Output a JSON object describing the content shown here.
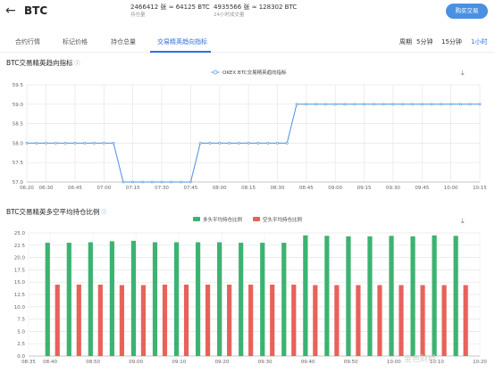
{
  "header": {
    "back_icon": "back-arrow-icon",
    "coin": "BTC",
    "stat1": {
      "value": "2466412 张 ≈ 64125 BTC",
      "label": "持仓量"
    },
    "stat2": {
      "value": "4935566 张 ≈ 128302 BTC",
      "label": "24小时成交量"
    },
    "buy_button": "购买交易"
  },
  "tabs": [
    {
      "label": "合约行情"
    },
    {
      "label": "标记价格"
    },
    {
      "label": "持仓总量"
    },
    {
      "label": "交易精英趋向指标",
      "active": true
    }
  ],
  "periods": {
    "label": "周期",
    "options": [
      {
        "label": "5分钟"
      },
      {
        "label": "15分钟"
      },
      {
        "label": "1小时",
        "active": true
      }
    ]
  },
  "watermark": "金色财经",
  "chart_data": [
    {
      "type": "line",
      "title": "BTC交易精英趋向指标",
      "legend": [
        "OKEX BTC交易精英趋向指标"
      ],
      "legend_position": "top-center",
      "grid": true,
      "ylim": [
        57.0,
        59.5
      ],
      "yticks": [
        "57.0",
        "57.5",
        "58.0",
        "58.5",
        "59.0",
        "59.5"
      ],
      "xticks": [
        "06:20",
        "06:30",
        "06:45",
        "07:00",
        "07:15",
        "07:30",
        "07:45",
        "08:00",
        "08:15",
        "08:30",
        "08:45",
        "09:00",
        "09:15",
        "09:30",
        "09:45",
        "10:00",
        "10:15"
      ],
      "series": [
        {
          "name": "OKEX BTC交易精英趋向指标",
          "color": "#4a90e2",
          "x": [
            "06:20",
            "06:25",
            "06:30",
            "06:35",
            "06:40",
            "06:45",
            "06:50",
            "06:55",
            "07:00",
            "07:05",
            "07:10",
            "07:15",
            "07:20",
            "07:25",
            "07:30",
            "07:35",
            "07:40",
            "07:45",
            "07:50",
            "07:55",
            "08:00",
            "08:05",
            "08:10",
            "08:15",
            "08:20",
            "08:25",
            "08:30",
            "08:35",
            "08:40",
            "08:45",
            "08:50",
            "08:55",
            "09:00",
            "09:05",
            "09:10",
            "09:15",
            "09:20",
            "09:25",
            "09:30",
            "09:35",
            "09:40",
            "09:45",
            "09:50",
            "09:55",
            "10:00",
            "10:05",
            "10:10",
            "10:15"
          ],
          "values": [
            58,
            58,
            58,
            58,
            58,
            58,
            58,
            58,
            58,
            58,
            57,
            57,
            57,
            57,
            57,
            57,
            57,
            57,
            58,
            58,
            58,
            58,
            58,
            58,
            58,
            58,
            58,
            58,
            59,
            59,
            59,
            59,
            59,
            59,
            59,
            59,
            59,
            59,
            59,
            59,
            59,
            59,
            59,
            59,
            59,
            59,
            59,
            59
          ]
        }
      ]
    },
    {
      "type": "bar",
      "title": "BTC交易精英多空平均持仓比例",
      "legend": [
        "多头平均持仓比例",
        "空头平均持仓比例"
      ],
      "legend_position": "top-center",
      "grid": true,
      "ylim": [
        0,
        25
      ],
      "yticks": [
        "0.0",
        "2.5",
        "5.0",
        "7.5",
        "10.0",
        "12.5",
        "15.0",
        "17.5",
        "20.0",
        "22.5",
        "25.0"
      ],
      "xticks": [
        "08:35",
        "08:40",
        "08:50",
        "09:00",
        "09:10",
        "09:20",
        "09:30",
        "09:40",
        "09:50",
        "10:00",
        "10:10",
        "10:20"
      ],
      "categories": [
        "08:40",
        "08:45",
        "08:50",
        "08:55",
        "09:00",
        "09:05",
        "09:10",
        "09:15",
        "09:20",
        "09:25",
        "09:30",
        "09:35",
        "09:40",
        "09:45",
        "09:50",
        "09:55",
        "10:00",
        "10:05",
        "10:10",
        "10:15"
      ],
      "series": [
        {
          "name": "多头平均持仓比例",
          "color": "#3cb371",
          "values": [
            23.0,
            23.0,
            23.1,
            23.3,
            23.4,
            23.1,
            23.1,
            23.1,
            23.1,
            23.0,
            23.0,
            23.0,
            24.5,
            24.4,
            24.3,
            24.3,
            24.4,
            24.3,
            24.5,
            24.4
          ]
        },
        {
          "name": "空头平均持仓比例",
          "color": "#e8625a",
          "values": [
            14.5,
            14.5,
            14.5,
            14.4,
            14.4,
            14.5,
            14.5,
            14.5,
            14.5,
            14.5,
            14.5,
            14.5,
            14.4,
            14.4,
            14.4,
            14.4,
            14.4,
            14.4,
            14.4,
            14.4
          ]
        }
      ]
    }
  ]
}
